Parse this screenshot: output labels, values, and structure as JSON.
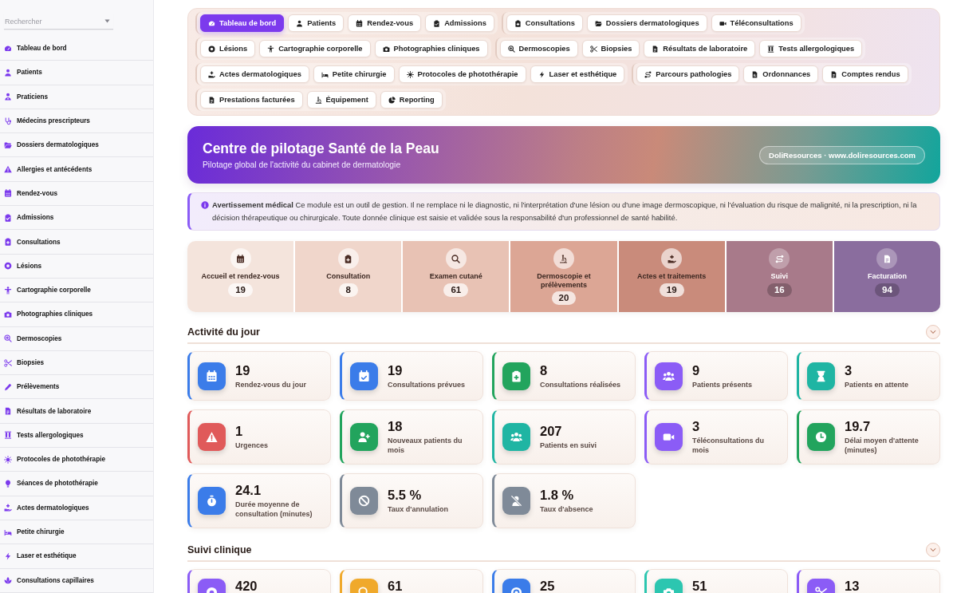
{
  "sidebar": {
    "search": {
      "placeholder": "Rechercher"
    },
    "items": [
      "Tableau de bord",
      "Patients",
      "Praticiens",
      "Médecins prescripteurs",
      "Dossiers dermatologiques",
      "Allergies et antécédents",
      "Rendez-vous",
      "Admissions",
      "Consultations",
      "Lésions",
      "Cartographie corporelle",
      "Photographies cliniques",
      "Dermoscopies",
      "Biopsies",
      "Prélèvements",
      "Résultats de laboratoire",
      "Tests allergologiques",
      "Protocoles de photothérapie",
      "Séances de photothérapie",
      "Actes dermatologiques",
      "Petite chirurgie",
      "Laser et esthétique",
      "Consultations capillaires"
    ]
  },
  "tab_groups": [
    {
      "tabs": [
        {
          "label": "Tableau de bord",
          "selected": true
        },
        {
          "label": "Patients",
          "selected": false
        },
        {
          "label": "Rendez-vous",
          "selected": false
        },
        {
          "label": "Admissions",
          "selected": false
        }
      ]
    },
    {
      "tabs": [
        {
          "label": "Consultations",
          "selected": false
        },
        {
          "label": "Dossiers dermatologiques",
          "selected": false
        },
        {
          "label": "Téléconsultations",
          "selected": false
        }
      ]
    },
    {
      "tabs": [
        {
          "label": "Lésions",
          "selected": false
        },
        {
          "label": "Cartographie corporelle",
          "selected": false
        },
        {
          "label": "Photographies cliniques",
          "selected": false
        }
      ]
    },
    {
      "tabs": [
        {
          "label": "Dermoscopies",
          "selected": false
        },
        {
          "label": "Biopsies",
          "selected": false
        },
        {
          "label": "Résultats de laboratoire",
          "selected": false
        },
        {
          "label": "Tests allergologiques",
          "selected": false
        }
      ]
    },
    {
      "tabs": [
        {
          "label": "Actes dermatologiques",
          "selected": false
        },
        {
          "label": "Petite chirurgie",
          "selected": false
        },
        {
          "label": "Protocoles de photothérapie",
          "selected": false
        },
        {
          "label": "Laser et esthétique",
          "selected": false
        }
      ]
    },
    {
      "tabs": [
        {
          "label": "Parcours pathologies",
          "selected": false
        },
        {
          "label": "Ordonnances",
          "selected": false
        },
        {
          "label": "Comptes rendus",
          "selected": false
        }
      ]
    },
    {
      "tabs": [
        {
          "label": "Prestations facturées",
          "selected": false
        },
        {
          "label": "Équipement",
          "selected": false
        },
        {
          "label": "Reporting",
          "selected": false
        }
      ]
    }
  ],
  "banner": {
    "title": "Centre de pilotage Santé de la Peau",
    "subtitle": "Pilotage global de l'activité du cabinet de dermatologie",
    "badge": "DoliResources · www.doliresources.com"
  },
  "notice": {
    "text": "**Avertissement médical** Ce module est un outil de gestion. Il ne remplace ni le diagnostic, ni l'interprétation d'une lésion ou d'une image dermoscopique, ni l'évaluation du risque de malignité, ni la prescription, ni la décision thérapeutique ou chirurgicale. Toute donnée clinique est saisie et validée sous la responsabilité d'un professionnel de santé habilité."
  },
  "pipeline": [
    {
      "label": "Accueil et rendez-vous",
      "count": "19",
      "color": "#f4e4dc"
    },
    {
      "label": "Consultation",
      "count": "8",
      "color": "#f0d6cb"
    },
    {
      "label": "Examen cutané",
      "count": "61",
      "color": "#e8c2b4"
    },
    {
      "label": "Dermoscopie et prélèvements",
      "count": "20",
      "color": "#dca695"
    },
    {
      "label": "Actes et traitements",
      "count": "19",
      "color": "#c98b7b"
    },
    {
      "label": "Suivi",
      "count": "16",
      "color": "#a87a8a"
    },
    {
      "label": "Facturation",
      "count": "94",
      "color": "#8a6d9e"
    }
  ],
  "sections": [
    {
      "title": "Activité du jour",
      "cards": [
        {
          "value": "19",
          "label": "Rendez-vous du jour",
          "color": "#3b7ce9"
        },
        {
          "value": "19",
          "label": "Consultations prévues",
          "color": "#3b7ce9"
        },
        {
          "value": "8",
          "label": "Consultations réalisées",
          "color": "#22a45d"
        },
        {
          "value": "9",
          "label": "Patients présents",
          "color": "#8b5cf6"
        },
        {
          "value": "3",
          "label": "Patients en attente",
          "color": "#1fb5a3"
        },
        {
          "value": "1",
          "label": "Urgences",
          "color": "#e05a5a"
        },
        {
          "value": "18",
          "label": "Nouveaux patients du mois",
          "color": "#22a45d"
        },
        {
          "value": "207",
          "label": "Patients en suivi",
          "color": "#1fb5a3"
        },
        {
          "value": "3",
          "label": "Téléconsultations du mois",
          "color": "#8b5cf6"
        },
        {
          "value": "19.7",
          "label": "Délai moyen d'attente (minutes)",
          "color": "#22a45d"
        },
        {
          "value": "24.1",
          "label": "Durée moyenne de consultation (minutes)",
          "color": "#3b7ce9"
        },
        {
          "value": "5.5 %",
          "label": "Taux d'annulation",
          "color": "#7f8a98"
        },
        {
          "value": "1.8 %",
          "label": "Taux d'absence",
          "color": "#7f8a98"
        }
      ]
    },
    {
      "title": "Suivi clinique",
      "cards": [
        {
          "value": "420",
          "color": "#8b5cf6"
        },
        {
          "value": "61",
          "color": "#f0a92b"
        },
        {
          "value": "25",
          "color": "#3b7ce9"
        },
        {
          "value": "51",
          "color": "#2cc6b0"
        },
        {
          "value": "13",
          "color": "#8b5cf6"
        }
      ]
    }
  ]
}
